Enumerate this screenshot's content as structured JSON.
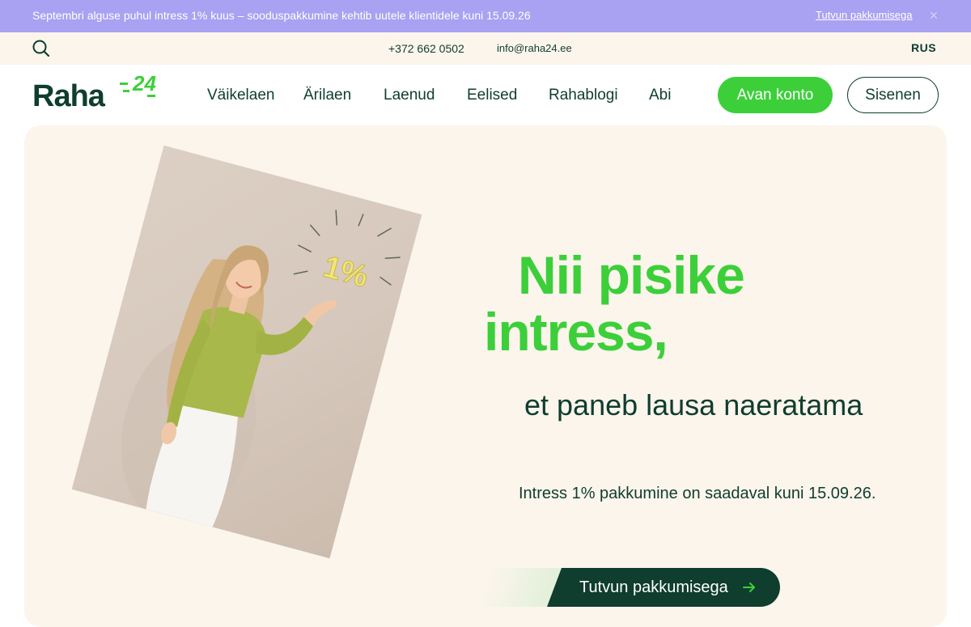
{
  "banner": {
    "text": "Septembri alguse puhul intress 1% kuus – sooduspakkumine kehtib uutele klientidele kuni 15.09.26",
    "link_label": "Tutvun pakkumisega",
    "close_icon": "close-icon",
    "close_glyph": "×",
    "background": "#a9a1f2"
  },
  "utility": {
    "search_icon": "search-icon",
    "phone": "+372 662 0502",
    "email": "info@raha24.ee",
    "language": "RUS",
    "background": "#fbf5ec"
  },
  "logo": {
    "word": "Raha",
    "number": "24"
  },
  "nav": {
    "items": [
      {
        "label": "Väikelaen"
      },
      {
        "label": "Ärilaen"
      },
      {
        "label": "Laenud"
      },
      {
        "label": "Eelised"
      },
      {
        "label": "Rahablogi"
      },
      {
        "label": "Abi"
      }
    ],
    "open_account_label": "Avan konto",
    "login_label": "Sisenen"
  },
  "hero": {
    "headline_line1": "Nii pisike",
    "headline_line2": "intress,",
    "subline": "et paneb lausa naeratama",
    "offer_note": "Intress 1% pakkumine on saadaval kuni 15.09.26.",
    "cta_label": "Tutvun pakkumisega",
    "cta_icon": "arrow-right-icon",
    "photo_badge": "1%"
  },
  "colors": {
    "brand_green": "#3ccf3a",
    "dark_green": "#0f3d2e",
    "cream": "#fbf5ec"
  }
}
